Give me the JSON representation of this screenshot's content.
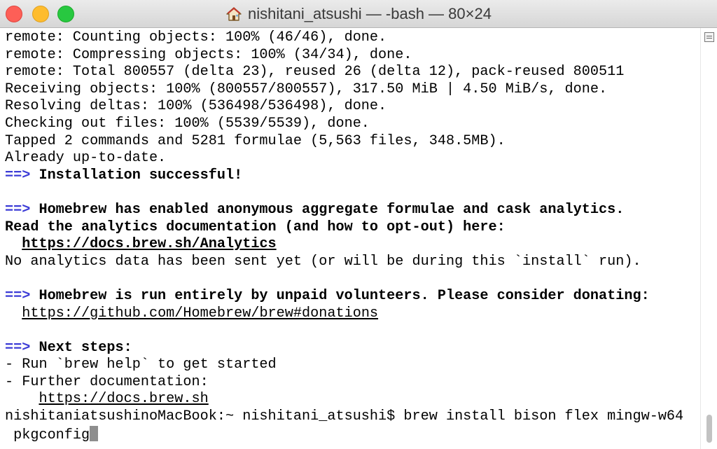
{
  "window": {
    "title": "nishitani_atsushi — -bash — 80×24"
  },
  "terminal": {
    "lines": [
      {
        "segments": [
          {
            "text": "remote: Counting objects: 100% (46/46), done."
          }
        ]
      },
      {
        "segments": [
          {
            "text": "remote: Compressing objects: 100% (34/34), done."
          }
        ]
      },
      {
        "segments": [
          {
            "text": "remote: Total 800557 (delta 23), reused 26 (delta 12), pack-reused 800511"
          }
        ]
      },
      {
        "segments": [
          {
            "text": "Receiving objects: 100% (800557/800557), 317.50 MiB | 4.50 MiB/s, done."
          }
        ]
      },
      {
        "segments": [
          {
            "text": "Resolving deltas: 100% (536498/536498), done."
          }
        ]
      },
      {
        "segments": [
          {
            "text": "Checking out files: 100% (5539/5539), done."
          }
        ]
      },
      {
        "segments": [
          {
            "text": "Tapped 2 commands and 5281 formulae (5,563 files, 348.5MB)."
          }
        ]
      },
      {
        "segments": [
          {
            "text": "Already up-to-date."
          }
        ]
      },
      {
        "segments": [
          {
            "text": "==>",
            "style": "arrow"
          },
          {
            "text": " Installation successful!",
            "style": "b"
          }
        ]
      },
      {
        "segments": [
          {
            "text": ""
          }
        ]
      },
      {
        "segments": [
          {
            "text": "==>",
            "style": "arrow"
          },
          {
            "text": " Homebrew has enabled anonymous aggregate formulae and cask analytics.",
            "style": "b"
          }
        ]
      },
      {
        "segments": [
          {
            "text": "Read the analytics documentation (and how to opt-out) here:",
            "style": "b"
          }
        ]
      },
      {
        "segments": [
          {
            "text": "  "
          },
          {
            "text": "https://docs.brew.sh/Analytics",
            "style": "b u",
            "link": true
          }
        ]
      },
      {
        "segments": [
          {
            "text": "No analytics data has been sent yet (or will be during this `install` run)."
          }
        ]
      },
      {
        "segments": [
          {
            "text": ""
          }
        ]
      },
      {
        "segments": [
          {
            "text": "==>",
            "style": "arrow"
          },
          {
            "text": " Homebrew is run entirely by unpaid volunteers. Please consider donating:",
            "style": "b"
          }
        ]
      },
      {
        "segments": [
          {
            "text": "  "
          },
          {
            "text": "https://github.com/Homebrew/brew#donations",
            "style": "u",
            "link": true
          }
        ]
      },
      {
        "segments": [
          {
            "text": ""
          }
        ]
      },
      {
        "segments": [
          {
            "text": "==>",
            "style": "arrow"
          },
          {
            "text": " Next steps:",
            "style": "b"
          }
        ]
      },
      {
        "segments": [
          {
            "text": "- Run `brew help` to get started"
          }
        ]
      },
      {
        "segments": [
          {
            "text": "- Further documentation:"
          }
        ]
      },
      {
        "segments": [
          {
            "text": "    "
          },
          {
            "text": "https://docs.brew.sh",
            "style": "u",
            "link": true
          }
        ]
      },
      {
        "segments": [
          {
            "text": "nishitaniatsushinoMacBook:~ nishitani_atsushi$ brew install bison flex mingw-w64"
          }
        ]
      },
      {
        "segments": [
          {
            "text": " pkgconfig"
          }
        ],
        "cursor": true
      }
    ]
  },
  "colors": {
    "arrow": "#3b3bd6",
    "cursor": "#8e8e8e",
    "close": "#fd5f57",
    "minimize": "#febc2e",
    "zoom": "#28c840"
  },
  "icons": {
    "title": "home-icon",
    "scrollbar": "split-pane-icon"
  }
}
